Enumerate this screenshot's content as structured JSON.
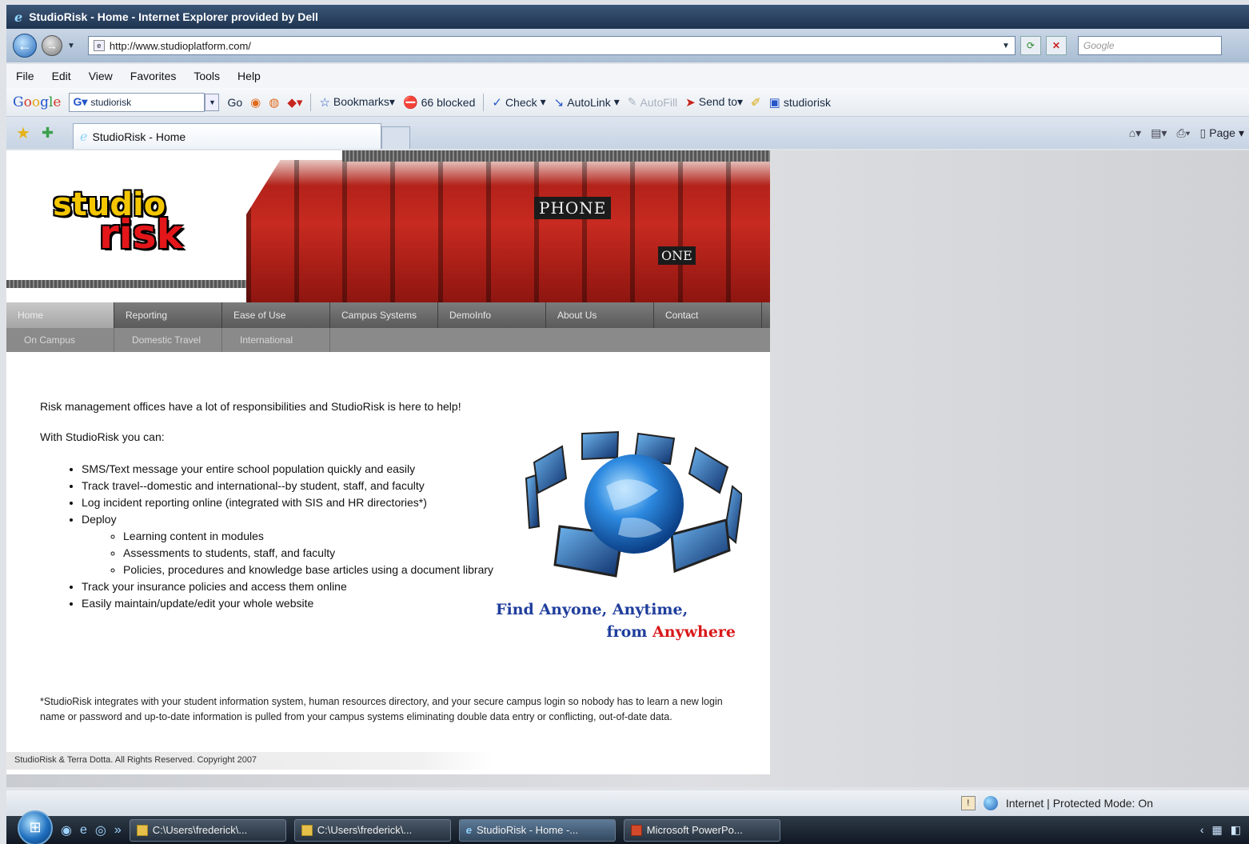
{
  "window": {
    "title": "StudioRisk - Home - Internet Explorer provided by Dell"
  },
  "address": {
    "url": "http://www.studioplatform.com/",
    "search_placeholder": "Google"
  },
  "menu": [
    "File",
    "Edit",
    "View",
    "Favorites",
    "Tools",
    "Help"
  ],
  "google_toolbar": {
    "search_value": "studiorisk",
    "go_label": "Go",
    "bookmarks_label": "Bookmarks▾",
    "blocked_label": "66 blocked",
    "check_label": "Check",
    "autolink_label": "AutoLink",
    "autofill_label": "AutoFill",
    "sendto_label": "Send to▾",
    "highlight_label": "studiorisk"
  },
  "tabs": {
    "active_label": "StudioRisk - Home",
    "page_label": "Page"
  },
  "site": {
    "logo_line1": "studio",
    "logo_line2": "risk",
    "phone_sign": "PHONE",
    "phone_sign2": "ONE",
    "nav_primary": [
      "Home",
      "Reporting",
      "Ease of Use",
      "Campus Systems",
      "DemoInfo",
      "About Us",
      "Contact"
    ],
    "nav_secondary": [
      "On Campus",
      "Domestic Travel",
      "International"
    ],
    "intro": "Risk management offices have a lot of responsibilities and StudioRisk is here to help!",
    "with_line": "With StudioRisk you can:",
    "bullets": [
      "SMS/Text message your entire school population quickly and easily",
      "Track travel--domestic and international--by student, staff, and faculty",
      "Log incident reporting online (integrated with SIS and HR directories*)",
      "Deploy"
    ],
    "sub_bullets": [
      "Learning content in modules",
      "Assessments to students, staff, and faculty",
      "Policies, procedures and knowledge base articles using a document library"
    ],
    "bullets_after": [
      "Track your insurance policies and access them online",
      "Easily maintain/update/edit your whole website"
    ],
    "tagline_line1": "Find Anyone, Anytime,",
    "tagline_from": "from",
    "tagline_anywhere": "Anywhere",
    "footnote": "*StudioRisk integrates with your student information system, human resources directory, and your secure campus login so nobody has to learn a new login name or password and up-to-date information is pulled from your campus systems eliminating double data entry or conflicting, out-of-date data.",
    "copyright": "StudioRisk & Terra Dotta. All Rights Reserved. Copyright 2007"
  },
  "status": {
    "zone_text": "Internet | Protected Mode: On"
  },
  "taskbar": {
    "buttons": [
      "C:\\Users\\frederick\\...",
      "C:\\Users\\frederick\\...",
      "StudioRisk - Home -...",
      "Microsoft PowerPo..."
    ]
  }
}
